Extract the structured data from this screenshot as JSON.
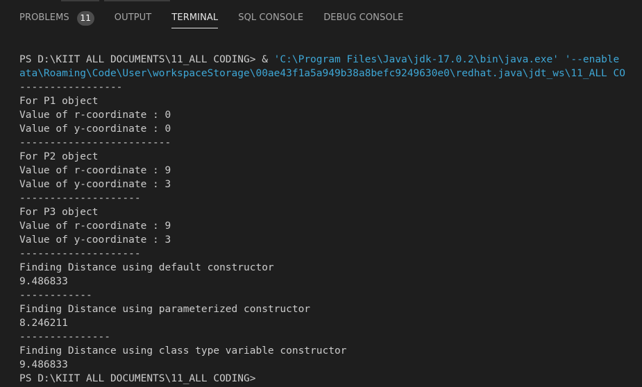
{
  "panel": {
    "tabs": [
      {
        "label": "PROBLEMS",
        "badge": "11"
      },
      {
        "label": "OUTPUT"
      },
      {
        "label": "TERMINAL"
      },
      {
        "label": "SQL CONSOLE"
      },
      {
        "label": "DEBUG CONSOLE"
      }
    ],
    "active_tab": "TERMINAL"
  },
  "terminal": {
    "command_prompt": "PS D:\\KIIT ALL DOCUMENTS\\11_ALL CODING>",
    "command_amp": " & ",
    "command_args": "'C:\\Program Files\\Java\\jdk-17.0.2\\bin\\java.exe' '--enable",
    "command_cont": "ata\\Roaming\\Code\\User\\workspaceStorage\\00ae43f1a5a949b38a8befc9249630e0\\redhat.java\\jdt_ws\\11_ALL CO",
    "output_lines": [
      "-----------------",
      "For P1 object",
      "Value of r-coordinate : 0",
      "Value of y-coordinate : 0",
      "-------------------------",
      "For P2 object",
      "Value of r-coordinate : 9",
      "Value of y-coordinate : 3",
      "--------------------",
      "For P3 object",
      "Value of r-coordinate : 9",
      "Value of y-coordinate : 3",
      "--------------------",
      "Finding Distance using default constructor",
      "9.486833",
      "------------",
      "Finding Distance using parameterized constructor",
      "8.246211",
      "---------------",
      "Finding Distance using class type variable constructor",
      "9.486833"
    ],
    "final_prompt": "PS D:\\KIIT ALL DOCUMENTS\\11_ALL CODING>"
  }
}
